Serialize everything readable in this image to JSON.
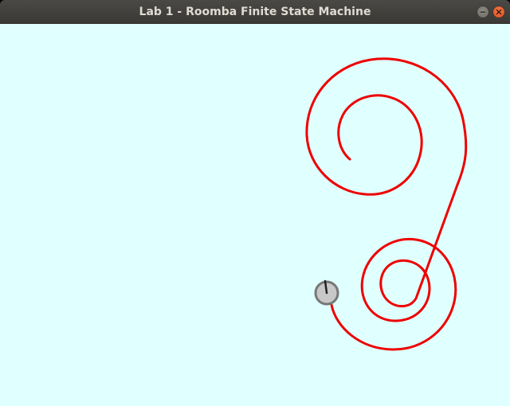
{
  "window": {
    "title": "Lab 1 - Roomba Finite State Machine"
  },
  "colors": {
    "canvas_background": "#e0ffff",
    "trail": "#ee0000",
    "robot_body": "#c8c8c8",
    "robot_outline": "#777777",
    "heading_indicator": "#222222"
  },
  "icons": {
    "minimize": "minimize-icon",
    "close": "close-icon"
  }
}
